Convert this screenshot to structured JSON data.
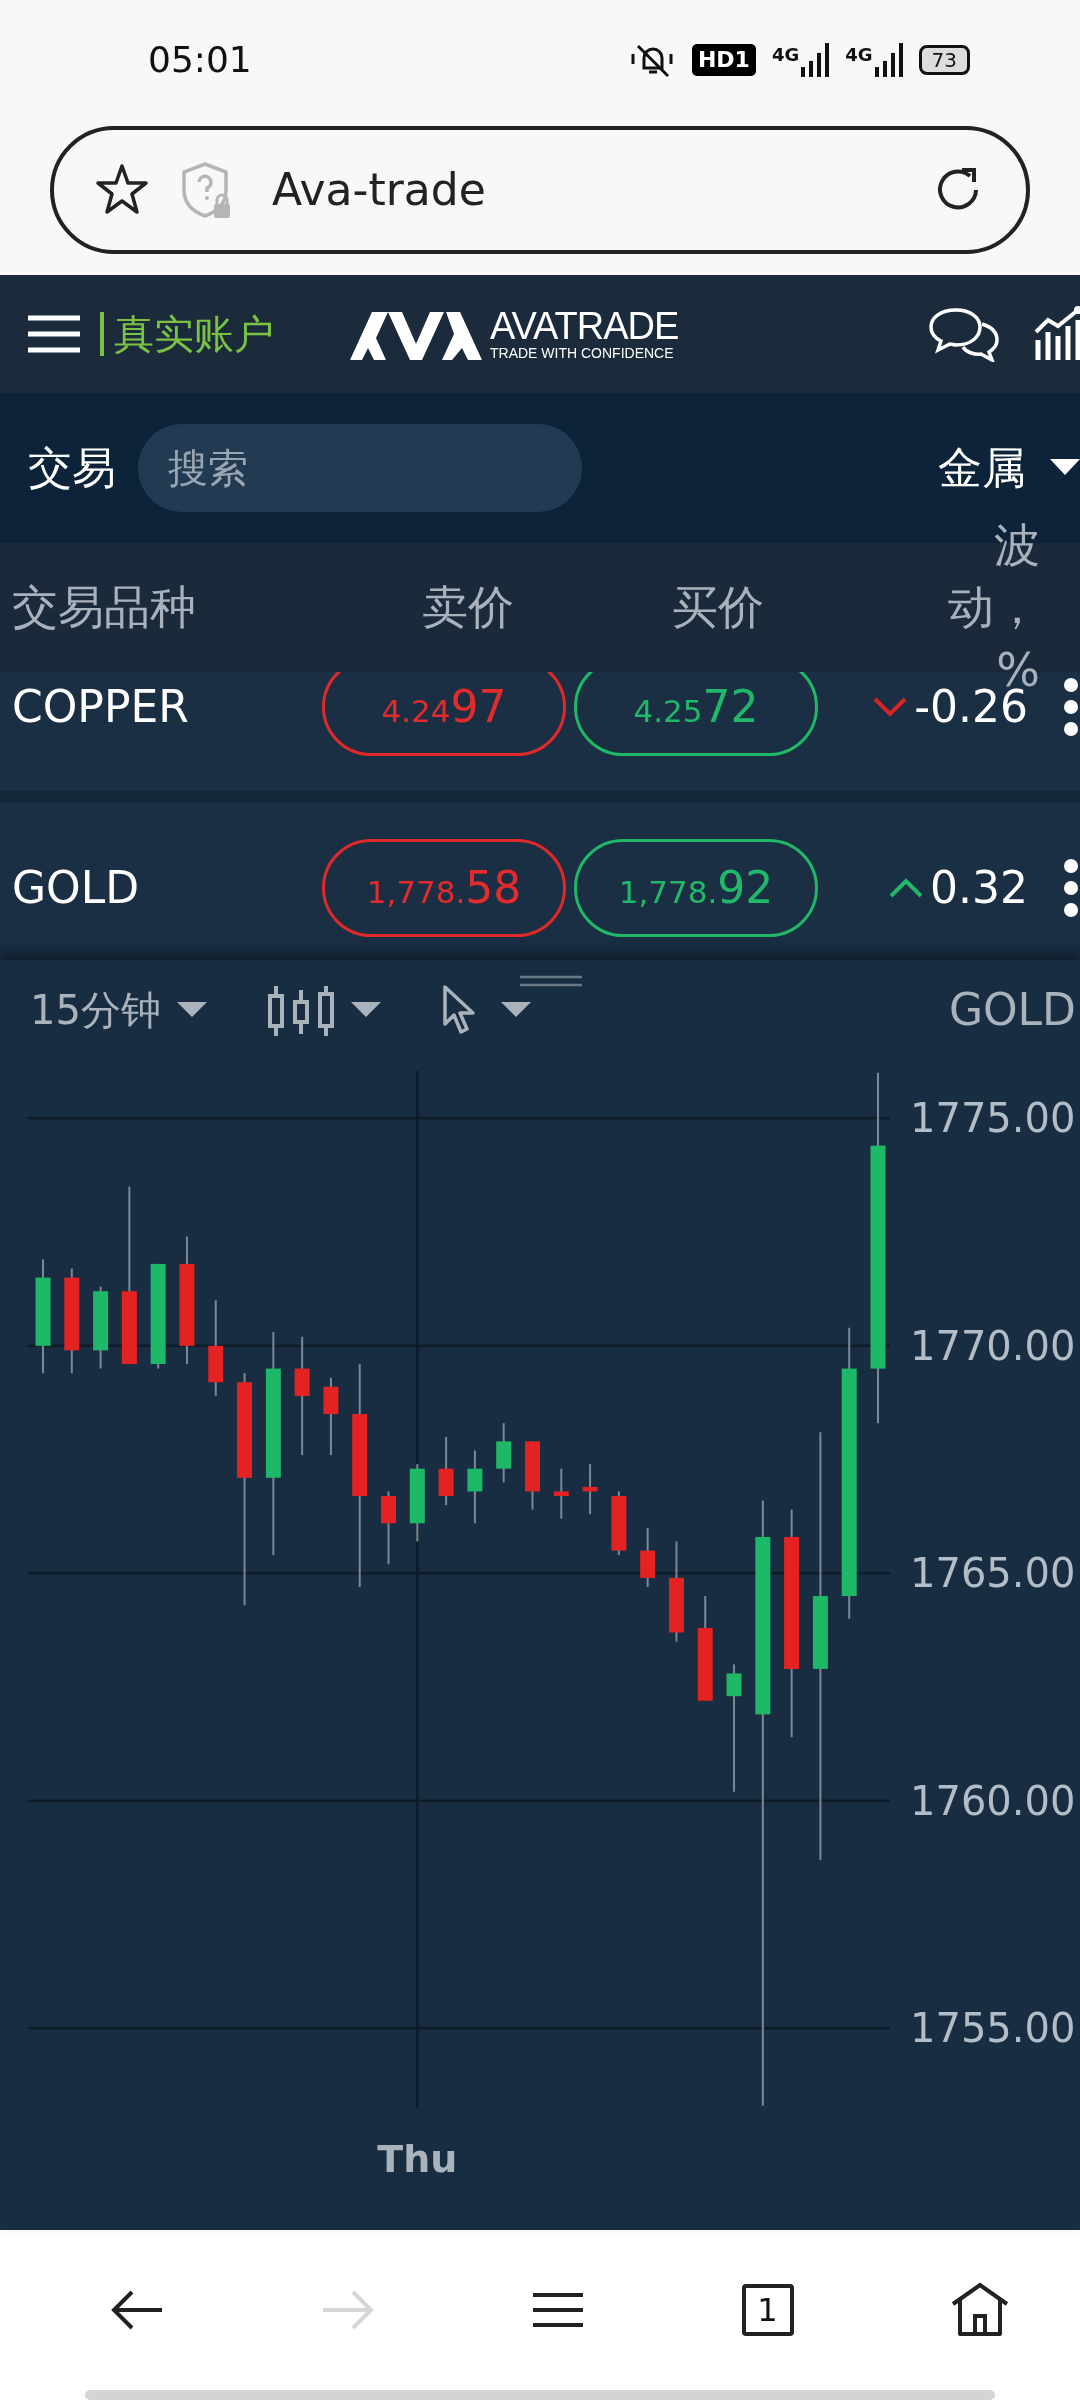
{
  "status_bar": {
    "time": "05:01",
    "hd_badge": "HD1",
    "networks": [
      "4G",
      "4G"
    ],
    "battery": "73"
  },
  "browser": {
    "url_title": "Ava-trade"
  },
  "app_header": {
    "account": "真实账户",
    "logo_name": "AVATRADE",
    "logo_tagline": "TRADE WITH CONFIDENCE"
  },
  "toolbar": {
    "title": "交易",
    "search": {
      "placeholder": "搜索"
    },
    "category": "金属"
  },
  "table": {
    "columns": [
      "交易品种",
      "卖价",
      "买价",
      "波动，%"
    ],
    "rows": [
      {
        "symbol": "COPPER",
        "sell": {
          "main": "4.24",
          "big": "97"
        },
        "buy": {
          "main": "4.25",
          "big": "72"
        },
        "kind": "down",
        "change": "-0.26"
      },
      {
        "symbol": "GOLD",
        "sell": {
          "main": "1,778.",
          "big": "58"
        },
        "buy": {
          "main": "1,778.",
          "big": "92"
        },
        "kind": "up",
        "change": "0.32"
      }
    ]
  },
  "chart": {
    "timeframe": "15分钟",
    "symbol": "GOLD",
    "chart_data": {
      "type": "candlestick",
      "ylim": [
        1753.25,
        1776.04
      ],
      "grid": true,
      "yticks": [
        {
          "value": 1755,
          "label": "1755.00"
        },
        {
          "value": 1760,
          "label": "1760.00"
        },
        {
          "value": 1765,
          "label": "1765.00"
        },
        {
          "value": 1770,
          "label": "1770.00"
        },
        {
          "value": 1775,
          "label": "1775.00"
        }
      ],
      "ohlc": [
        [
          1770.0,
          1771.9,
          1769.4,
          1771.5
        ],
        [
          1771.5,
          1771.7,
          1769.4,
          1769.9
        ],
        [
          1769.9,
          1771.3,
          1769.5,
          1771.2
        ],
        [
          1771.2,
          1773.5,
          1769.6,
          1769.6
        ],
        [
          1769.6,
          1771.8,
          1769.5,
          1771.8
        ],
        [
          1771.8,
          1772.4,
          1769.6,
          1770.0
        ],
        [
          1770.0,
          1771.0,
          1768.9,
          1769.2
        ],
        [
          1769.2,
          1769.4,
          1764.3,
          1767.1
        ],
        [
          1767.1,
          1770.3,
          1765.4,
          1769.5
        ],
        [
          1769.5,
          1770.2,
          1767.6,
          1768.9
        ],
        [
          1769.1,
          1769.3,
          1767.6,
          1768.5
        ],
        [
          1768.5,
          1769.6,
          1764.7,
          1766.7
        ],
        [
          1766.7,
          1766.8,
          1765.2,
          1766.1
        ],
        [
          1766.1,
          1767.4,
          1765.7,
          1767.3
        ],
        [
          1767.3,
          1768.0,
          1766.5,
          1766.7
        ],
        [
          1766.8,
          1767.7,
          1766.1,
          1767.3
        ],
        [
          1767.3,
          1768.3,
          1767.0,
          1767.9
        ],
        [
          1767.9,
          1767.9,
          1766.4,
          1766.8
        ],
        [
          1766.8,
          1767.3,
          1766.2,
          1766.7
        ],
        [
          1766.9,
          1767.4,
          1766.3,
          1766.8
        ],
        [
          1766.7,
          1766.8,
          1765.4,
          1765.5
        ],
        [
          1765.5,
          1766.0,
          1764.7,
          1764.9
        ],
        [
          1764.9,
          1765.7,
          1763.5,
          1763.7
        ],
        [
          1763.8,
          1764.5,
          1762.2,
          1762.2
        ],
        [
          1762.3,
          1763.0,
          1760.2,
          1762.8
        ],
        [
          1761.9,
          1766.6,
          1753.3,
          1765.8
        ],
        [
          1765.8,
          1766.4,
          1761.4,
          1762.9
        ],
        [
          1762.9,
          1768.1,
          1758.7,
          1764.5
        ],
        [
          1764.5,
          1770.4,
          1764.0,
          1769.5
        ],
        [
          1769.5,
          1776.0,
          1768.3,
          1774.4
        ]
      ]
    },
    "time_label": "Thu"
  },
  "bottom_nav": {
    "forward_disabled": true,
    "tab_count": "1"
  }
}
